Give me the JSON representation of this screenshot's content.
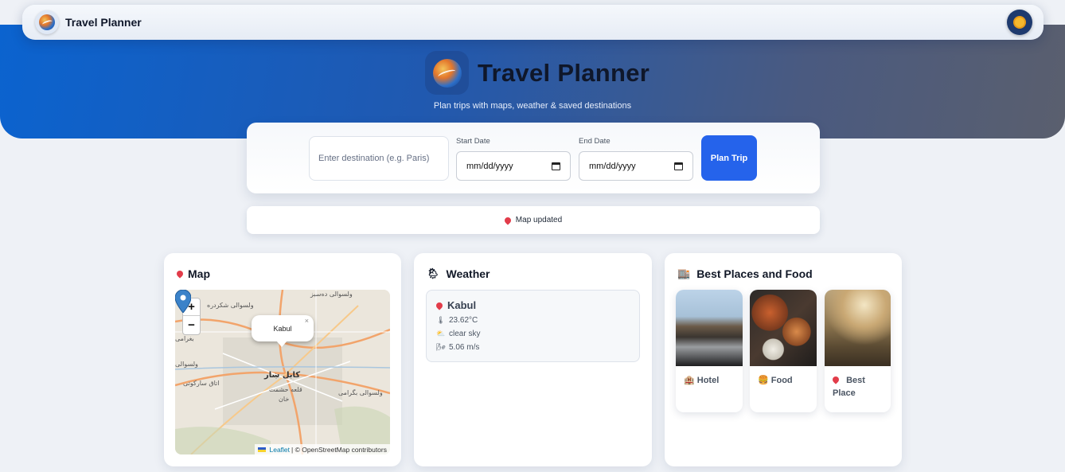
{
  "navbar": {
    "title": "Travel Planner",
    "logo_icon": "globe-logo-icon",
    "theme_icon": "sun-icon"
  },
  "hero": {
    "title": "Travel Planner",
    "subtitle": "Plan trips with maps, weather & saved destinations"
  },
  "form": {
    "destination_placeholder": "Enter destination (e.g. Paris)",
    "start_label": "Start Date",
    "start_value": "mm/dd/yyyy",
    "end_label": "End Date",
    "end_value": "mm/dd/yyyy",
    "submit_label": "Plan Trip"
  },
  "status": {
    "icon": "pin-icon",
    "text": "Map updated"
  },
  "map_card": {
    "title": "Map",
    "icon": "pin-icon",
    "zoom_in": "+",
    "zoom_out": "−",
    "popup_text": "Kabul",
    "popup_close": "×",
    "attribution_link": "Leaflet",
    "attribution_text": "| © OpenStreetMap contributors",
    "map_labels": [
      "ولسوالی ده‌سبز",
      "ولسوالی شکردره",
      "بغرامی",
      "ولسوالی",
      "کابل ښار",
      "اتاق سارکوتی",
      "قلعه حشمت",
      "خان",
      "ولسوالی بگرامی"
    ]
  },
  "weather_card": {
    "title": "Weather",
    "icon": "weather-icon",
    "city": "Kabul",
    "temperature": "23.62°C",
    "condition": "clear sky",
    "wind": "5.06 m/s"
  },
  "places_card": {
    "title": "Best Places and Food",
    "icon": "building-icon",
    "items": [
      {
        "label": "Hotel",
        "icon": "hotel-icon"
      },
      {
        "label": "Food",
        "icon": "burger-icon"
      },
      {
        "label": "Best Place",
        "icon": "pin-icon"
      }
    ]
  },
  "colors": {
    "accent": "#2563eb",
    "hero_start": "#0b63cf",
    "hero_end": "#5a5f6e",
    "pin": "#e23c4a"
  }
}
